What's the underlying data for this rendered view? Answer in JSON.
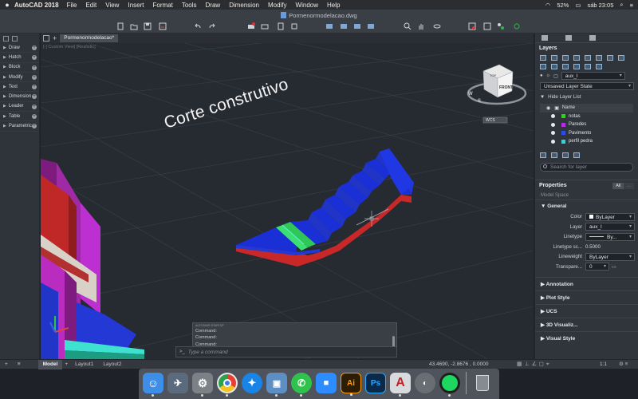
{
  "menubar": {
    "apple_icon": "apple-logo-icon",
    "app_name": "AutoCAD 2018",
    "items": [
      "File",
      "Edit",
      "View",
      "Insert",
      "Format",
      "Tools",
      "Draw",
      "Dimension",
      "Modify",
      "Window",
      "Help"
    ],
    "battery": "52%",
    "clock": "sáb 23:05"
  },
  "window": {
    "document_title": "Pormenormodelacao.dwg"
  },
  "palette": {
    "items": [
      "Draw",
      "Hatch",
      "Block",
      "Modify",
      "Text",
      "Dimension",
      "Leader",
      "Table",
      "Parametric"
    ]
  },
  "tabs": {
    "drawing_tab": "Pormenormodelacao*"
  },
  "viewport": {
    "label": "[-] Custom View] [Realistic]",
    "heading": "Corte construtivo",
    "viewcube": {
      "top": "TOP",
      "front": "FRONT",
      "west": "W",
      "south": "S",
      "wcs": "WCS"
    }
  },
  "command": {
    "history_small": "AUTOSAVE:STARTUP",
    "history": [
      "Command:",
      "Command:",
      "Command:"
    ],
    "prompt_symbol": ">_",
    "placeholder": "Type a command"
  },
  "layers": {
    "title": "Layers",
    "current_layer": "aux_l",
    "layer_state": "Unsaved Layer State",
    "hide_list_label": "Hide Layer List",
    "name_header": "Name",
    "rows": [
      {
        "name": "notas",
        "color": "#2fd11f"
      },
      {
        "name": "Paredes",
        "color": "#b030e0"
      },
      {
        "name": "Pavimento",
        "color": "#2c4de6"
      },
      {
        "name": "perfil pedra",
        "color": "#3dd0d0"
      }
    ],
    "search_placeholder": "Search for layer"
  },
  "properties": {
    "title": "Properties",
    "filter_all": "All",
    "filter_other": "...",
    "context": "Model Space",
    "general_label": "General",
    "rows": [
      {
        "key": "Color",
        "value": "ByLayer"
      },
      {
        "key": "Layer",
        "value": "aux_l"
      },
      {
        "key": "Linetype",
        "value": "By..."
      },
      {
        "key": "Linetype sc...",
        "value": "0.5000"
      },
      {
        "key": "Lineweight",
        "value": "ByLayer"
      },
      {
        "key": "Transpare...",
        "value": "0"
      }
    ],
    "collapsed_sections": [
      "Annotation",
      "Plot Style",
      "UCS",
      "3D Visualiz...",
      "Visual Style"
    ]
  },
  "statusbar": {
    "tabs": [
      "Model",
      "Layout1",
      "Layout2"
    ],
    "coordinates": "43.4690, -2.8676 , 0.0000",
    "scale": "1:1"
  },
  "dock": {
    "apps": [
      {
        "name": "finder-icon",
        "color": "#3e8ee8",
        "glyph": ""
      },
      {
        "name": "launchpad-icon",
        "color": "#5b6b7d",
        "glyph": ""
      },
      {
        "name": "system-preferences-icon",
        "color": "#7c8087",
        "glyph": ""
      },
      {
        "name": "chrome-icon",
        "color": "#e7e7e7",
        "glyph": ""
      },
      {
        "name": "safari-icon",
        "color": "#1a84e6",
        "glyph": ""
      },
      {
        "name": "preview-icon",
        "color": "#5d8fc5",
        "glyph": ""
      },
      {
        "name": "whatsapp-icon",
        "color": "#2fc24c",
        "glyph": ""
      },
      {
        "name": "zoom-icon",
        "color": "#2d8cff",
        "glyph": ""
      },
      {
        "name": "illustrator-icon",
        "color": "#2d1d04",
        "glyph": "Ai"
      },
      {
        "name": "photoshop-icon",
        "color": "#0a2a4a",
        "glyph": "Ps"
      },
      {
        "name": "autocad-icon",
        "color": "#d8dadd",
        "glyph": ""
      },
      {
        "name": "autocad-app-icon",
        "color": "#6a6e74",
        "glyph": ""
      },
      {
        "name": "spotify-icon",
        "color": "#1f1f1f",
        "glyph": ""
      },
      {
        "name": "trash-icon",
        "color": "#9aa0a6",
        "glyph": ""
      }
    ]
  }
}
